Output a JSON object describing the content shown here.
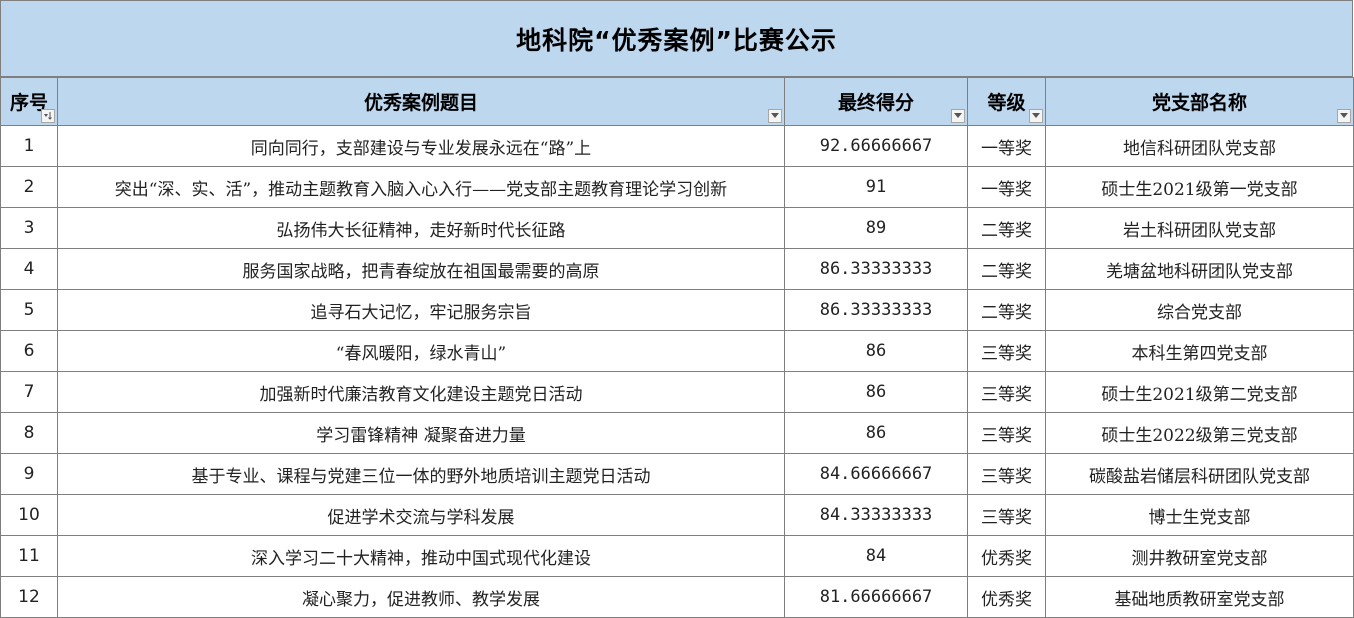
{
  "title": "地科院“优秀案例”比赛公示",
  "columns": [
    {
      "label": "序号",
      "filter_icon": "sort-filter-icon"
    },
    {
      "label": "优秀案例题目",
      "filter_icon": "dropdown-filter-icon"
    },
    {
      "label": "最终得分",
      "filter_icon": "dropdown-filter-icon"
    },
    {
      "label": "等级",
      "filter_icon": "dropdown-filter-icon"
    },
    {
      "label": "党支部名称",
      "filter_icon": "dropdown-filter-icon"
    }
  ],
  "rows": [
    {
      "no": "1",
      "topic": "同向同行，支部建设与专业发展永远在“路”上",
      "score": "92.66666667",
      "grade": "一等奖",
      "branch": "地信科研团队党支部"
    },
    {
      "no": "2",
      "topic": "突出“深、实、活”，推动主题教育入脑入心入行——党支部主题教育理论学习创新",
      "score": "91",
      "grade": "一等奖",
      "branch": "硕士生2021级第一党支部"
    },
    {
      "no": "3",
      "topic": "弘扬伟大长征精神，走好新时代长征路",
      "score": "89",
      "grade": "二等奖",
      "branch": "岩土科研团队党支部"
    },
    {
      "no": "4",
      "topic": "服务国家战略，把青春绽放在祖国最需要的高原",
      "score": "86.33333333",
      "grade": "二等奖",
      "branch": "羌塘盆地科研团队党支部"
    },
    {
      "no": "5",
      "topic": "追寻石大记忆，牢记服务宗旨",
      "score": "86.33333333",
      "grade": "二等奖",
      "branch": "综合党支部"
    },
    {
      "no": "6",
      "topic": "“春风暖阳，绿水青山”",
      "score": "86",
      "grade": "三等奖",
      "branch": "本科生第四党支部"
    },
    {
      "no": "7",
      "topic": "加强新时代廉洁教育文化建设主题党日活动",
      "score": "86",
      "grade": "三等奖",
      "branch": "硕士生2021级第二党支部"
    },
    {
      "no": "8",
      "topic": "学习雷锋精神 凝聚奋进力量",
      "score": "86",
      "grade": "三等奖",
      "branch": "硕士生2022级第三党支部"
    },
    {
      "no": "9",
      "topic": "基于专业、课程与党建三位一体的野外地质培训主题党日活动",
      "score": "84.66666667",
      "grade": "三等奖",
      "branch": "碳酸盐岩储层科研团队党支部"
    },
    {
      "no": "10",
      "topic": "促进学术交流与学科发展",
      "score": "84.33333333",
      "grade": "三等奖",
      "branch": "博士生党支部"
    },
    {
      "no": "11",
      "topic": "深入学习二十大精神，推动中国式现代化建设",
      "score": "84",
      "grade": "优秀奖",
      "branch": "测井教研室党支部"
    },
    {
      "no": "12",
      "topic": "凝心聚力，促进教师、教学发展",
      "score": "81.66666667",
      "grade": "优秀奖",
      "branch": "基础地质教研室党支部"
    }
  ],
  "colors": {
    "header_bg": "#bdd7ee",
    "grid": "#7f7f7f"
  }
}
